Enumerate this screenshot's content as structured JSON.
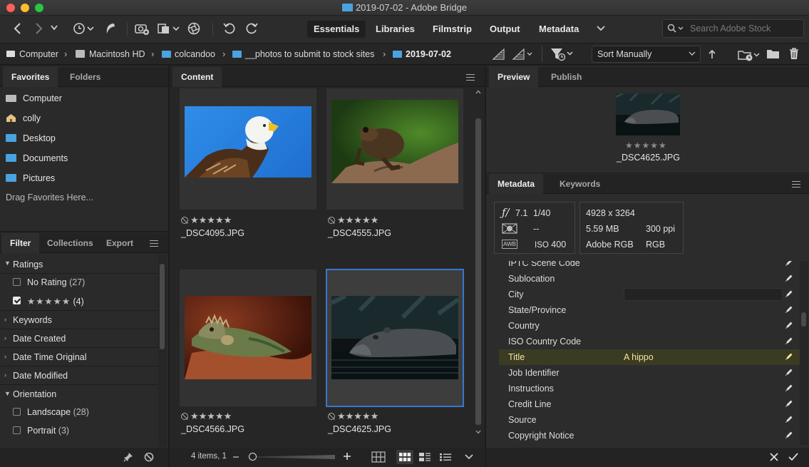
{
  "window": {
    "title": "2019-07-02 - Adobe Bridge"
  },
  "workspaces": [
    "Essentials",
    "Libraries",
    "Filmstrip",
    "Output",
    "Metadata"
  ],
  "search": {
    "placeholder": "Search Adobe Stock"
  },
  "breadcrumb": [
    "Computer",
    "Macintosh HD",
    "colcandoo",
    "__photos to submit to stock sites",
    "2019-07-02"
  ],
  "sort": {
    "value": "Sort Manually"
  },
  "left_tabs": [
    "Favorites",
    "Folders"
  ],
  "favorites": [
    "Computer",
    "colly",
    "Desktop",
    "Documents",
    "Pictures"
  ],
  "favorites_hint": "Drag Favorites Here...",
  "filter_tabs": [
    "Filter",
    "Collections",
    "Export"
  ],
  "filter": {
    "ratings_label": "Ratings",
    "no_rating_label": "No Rating",
    "no_rating_count": "(27)",
    "five_star_label": "★★★★★",
    "five_star_count": "(4)",
    "keywords": "Keywords",
    "date_created": "Date Created",
    "date_time_original": "Date Time Original",
    "date_modified": "Date Modified",
    "orientation": "Orientation",
    "landscape_label": "Landscape",
    "landscape_count": "(28)",
    "portrait_label": "Portrait",
    "portrait_count": "(3)"
  },
  "content_tab": "Content",
  "thumbnails": [
    {
      "name": "_DSC4095.JPG",
      "stars": "★★★★★"
    },
    {
      "name": "_DSC4555.JPG",
      "stars": "★★★★★"
    },
    {
      "name": "_DSC4566.JPG",
      "stars": "★★★★★"
    },
    {
      "name": "_DSC4625.JPG",
      "stars": "★★★★★"
    }
  ],
  "status": {
    "items": "4 items, 1"
  },
  "right_tabs": [
    "Preview",
    "Publish"
  ],
  "preview": {
    "stars": "★★★★★",
    "name": "_DSC4625.JPG"
  },
  "meta_tabs": [
    "Metadata",
    "Keywords"
  ],
  "camera": {
    "aperture": "7.1",
    "aperture_prefix": "ƒ/",
    "shutter": "1/40",
    "metering": "--",
    "iso_label": "ISO",
    "iso": "400",
    "awb": "AWB",
    "dimensions": "4928 x 3264",
    "size": "5.59 MB",
    "ppi": "300 ppi",
    "profile": "Adobe RGB",
    "mode": "RGB"
  },
  "metadata": [
    {
      "key": "IPTC Scene Code",
      "value": ""
    },
    {
      "key": "Sublocation",
      "value": ""
    },
    {
      "key": "City",
      "value": ""
    },
    {
      "key": "State/Province",
      "value": ""
    },
    {
      "key": "Country",
      "value": ""
    },
    {
      "key": "ISO Country Code",
      "value": ""
    },
    {
      "key": "Title",
      "value": "A hippo"
    },
    {
      "key": "Job Identifier",
      "value": ""
    },
    {
      "key": "Instructions",
      "value": ""
    },
    {
      "key": "Credit Line",
      "value": ""
    },
    {
      "key": "Source",
      "value": ""
    },
    {
      "key": "Copyright Notice",
      "value": ""
    }
  ],
  "colors": {
    "accent": "#3478d0",
    "folder": "#4aa3df",
    "highlight_text": "#f2e6a0"
  }
}
